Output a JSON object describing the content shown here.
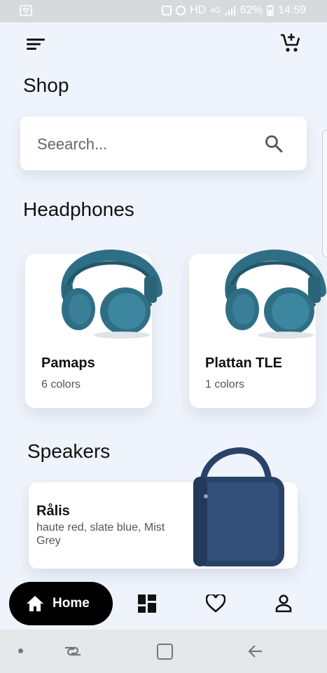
{
  "status_bar": {
    "network": "4G",
    "battery": "62%",
    "time": "14:59",
    "hd": "HD",
    "icons": [
      "wifi-icon",
      "nfc-icon",
      "alarm-icon",
      "signal-icon",
      "battery-icon"
    ]
  },
  "header": {
    "title": "Shop",
    "icons": [
      "menu-icon",
      "add-to-cart-icon"
    ]
  },
  "search": {
    "placeholder": "Seearch..."
  },
  "headphones": {
    "title": "Headphones",
    "items": [
      {
        "name": "Pamaps",
        "colors": "6 colors"
      },
      {
        "name": "Plattan TLE",
        "colors": "1 colors"
      }
    ]
  },
  "speakers": {
    "title": "Speakers",
    "items": [
      {
        "name": "Rålis",
        "colors": "haute red, slate blue, Mist Grey"
      }
    ]
  },
  "nav": {
    "home_label": "Home",
    "items": [
      "home-icon",
      "dashboard-icon",
      "heart-icon",
      "profile-icon"
    ]
  },
  "colors": {
    "background": "#eff3fb",
    "headphone": "#2f6f86",
    "speaker": "#2a4266",
    "nav_active": "#000000"
  }
}
